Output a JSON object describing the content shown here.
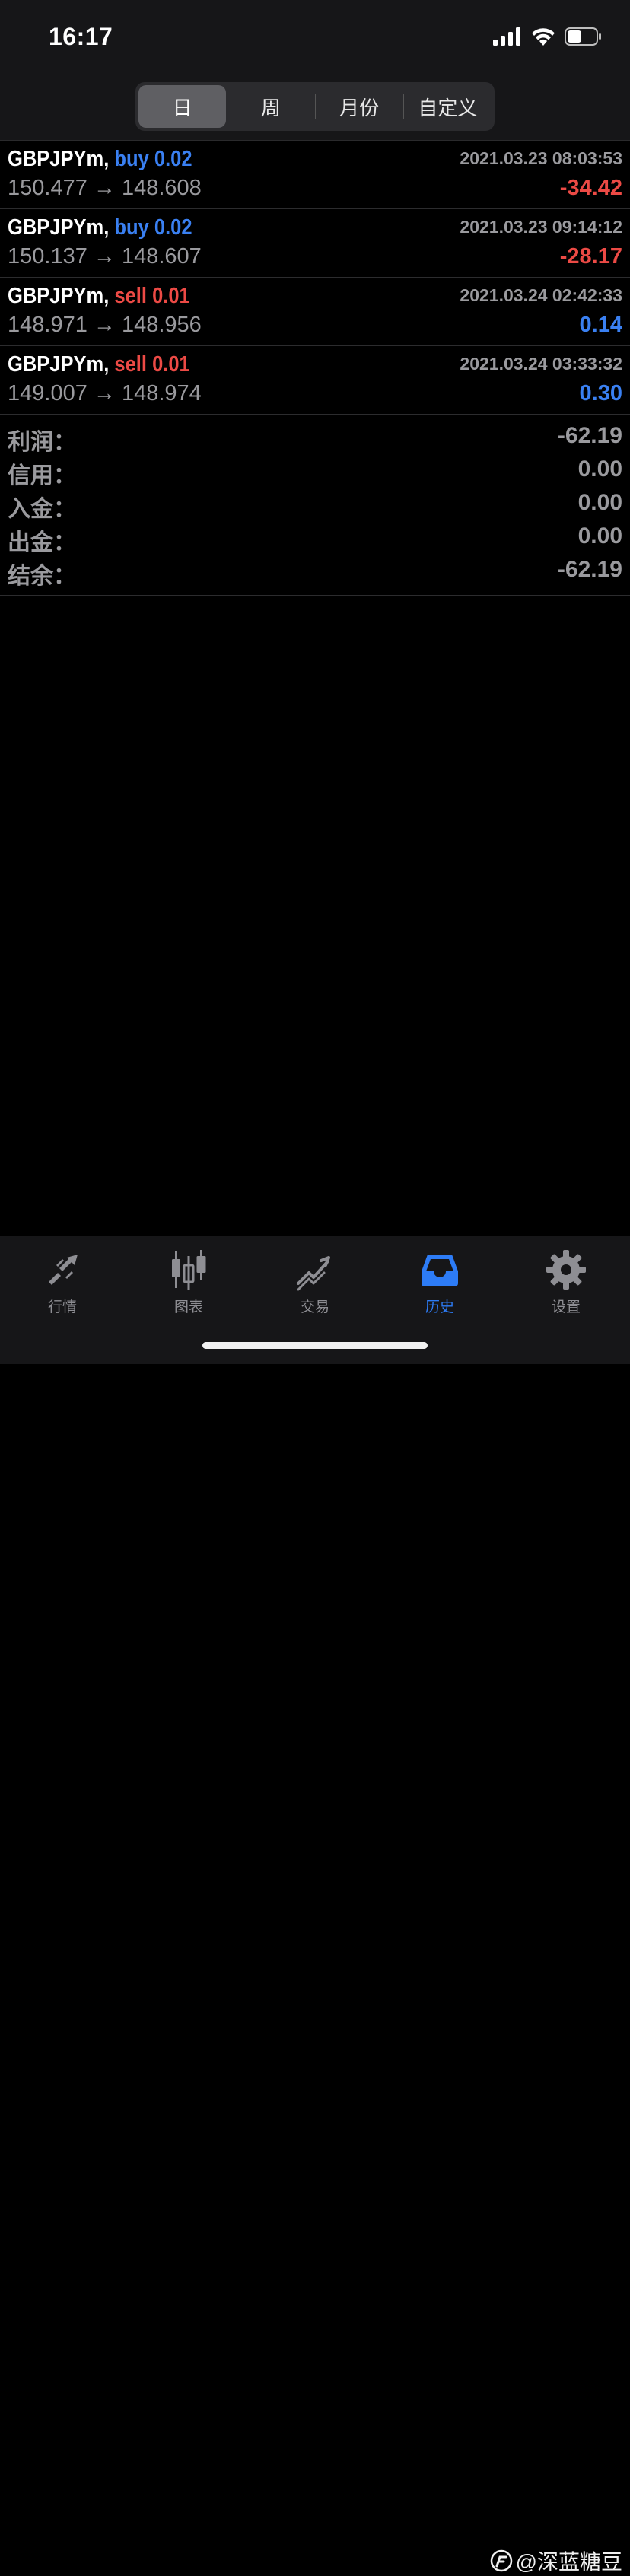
{
  "status_bar": {
    "time": "16:17",
    "icons": [
      "signal-icon",
      "wifi-icon",
      "battery-icon"
    ]
  },
  "period_tabs": [
    {
      "label": "日",
      "active": true
    },
    {
      "label": "周",
      "active": false
    },
    {
      "label": "月份",
      "active": false
    },
    {
      "label": "自定义",
      "active": false
    }
  ],
  "trades": [
    {
      "symbol": "GBPJPYm,",
      "side": "buy",
      "volume": "0.02",
      "time": "2021.03.23 08:03:53",
      "prices": "150.477 → 148.608",
      "profit": "-34.42"
    },
    {
      "symbol": "GBPJPYm,",
      "side": "buy",
      "volume": "0.02",
      "time": "2021.03.23 09:14:12",
      "prices": "150.137 → 148.607",
      "profit": "-28.17"
    },
    {
      "symbol": "GBPJPYm,",
      "side": "sell",
      "volume": "0.01",
      "time": "2021.03.24 02:42:33",
      "prices": "148.971 → 148.956",
      "profit": "0.14"
    },
    {
      "symbol": "GBPJPYm,",
      "side": "sell",
      "volume": "0.01",
      "time": "2021.03.24 03:33:32",
      "prices": "149.007 → 148.974",
      "profit": "0.30"
    }
  ],
  "summary": [
    {
      "label": "利润：",
      "value": "-62.19"
    },
    {
      "label": "信用：",
      "value": "0.00"
    },
    {
      "label": "入金：",
      "value": "0.00"
    },
    {
      "label": "出金：",
      "value": "0.00"
    },
    {
      "label": "结余：",
      "value": "-62.19"
    }
  ],
  "tab_bar": [
    {
      "label": "行情",
      "icon": "quotes-icon",
      "active": false
    },
    {
      "label": "图表",
      "icon": "chart-icon",
      "active": false
    },
    {
      "label": "交易",
      "icon": "trade-icon",
      "active": false
    },
    {
      "label": "历史",
      "icon": "history-icon",
      "active": true
    },
    {
      "label": "设置",
      "icon": "gear-icon",
      "active": false
    }
  ],
  "watermark": "@深蓝糖豆",
  "colors": {
    "buy": "#3a80f2",
    "sell": "#ec4a45",
    "profit_negative": "#ec4a45",
    "profit_positive": "#3a80f2",
    "active_tab": "#2d7cf6"
  }
}
